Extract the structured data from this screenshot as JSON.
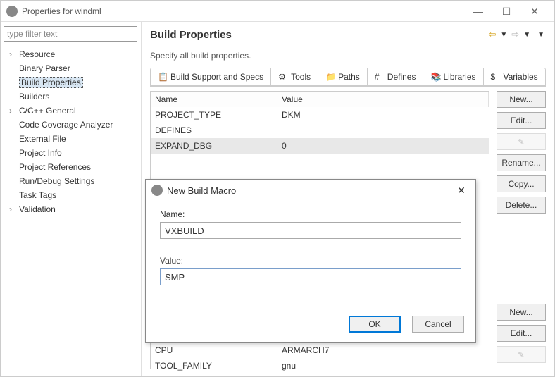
{
  "window": {
    "title": "Properties for windml"
  },
  "filter_placeholder": "type filter text",
  "tree": {
    "items": [
      {
        "label": "Resource",
        "parent": true
      },
      {
        "label": "Binary Parser"
      },
      {
        "label": "Build Properties",
        "selected": true
      },
      {
        "label": "Builders"
      },
      {
        "label": "C/C++ General",
        "parent": true
      },
      {
        "label": "Code Coverage Analyzer"
      },
      {
        "label": "External File"
      },
      {
        "label": "Project Info"
      },
      {
        "label": "Project References"
      },
      {
        "label": "Run/Debug Settings"
      },
      {
        "label": "Task Tags"
      },
      {
        "label": "Validation",
        "parent": true
      }
    ]
  },
  "page": {
    "heading": "Build Properties",
    "description": "Specify all build properties."
  },
  "tabs": [
    {
      "label": "Build Support and Specs"
    },
    {
      "label": "Tools"
    },
    {
      "label": "Paths"
    },
    {
      "label": "Defines"
    },
    {
      "label": "Libraries"
    },
    {
      "label": "Variables",
      "active": true
    }
  ],
  "table": {
    "headers": {
      "name": "Name",
      "value": "Value"
    },
    "rows": [
      {
        "name": "PROJECT_TYPE",
        "value": "DKM"
      },
      {
        "name": "DEFINES",
        "value": ""
      },
      {
        "name": "EXPAND_DBG",
        "value": "0",
        "selected": true
      }
    ],
    "lower_rows": [
      {
        "name": "CPU",
        "value": "ARMARCH7"
      },
      {
        "name": "TOOL_FAMILY",
        "value": "gnu"
      }
    ]
  },
  "buttons": {
    "new": "New...",
    "edit": "Edit...",
    "rename": "Rename...",
    "copy": "Copy...",
    "delete": "Delete..."
  },
  "dialog": {
    "title": "New Build Macro",
    "name_label": "Name:",
    "name_value": "VXBUILD",
    "value_label": "Value:",
    "value_value": "SMP",
    "ok": "OK",
    "cancel": "Cancel"
  }
}
